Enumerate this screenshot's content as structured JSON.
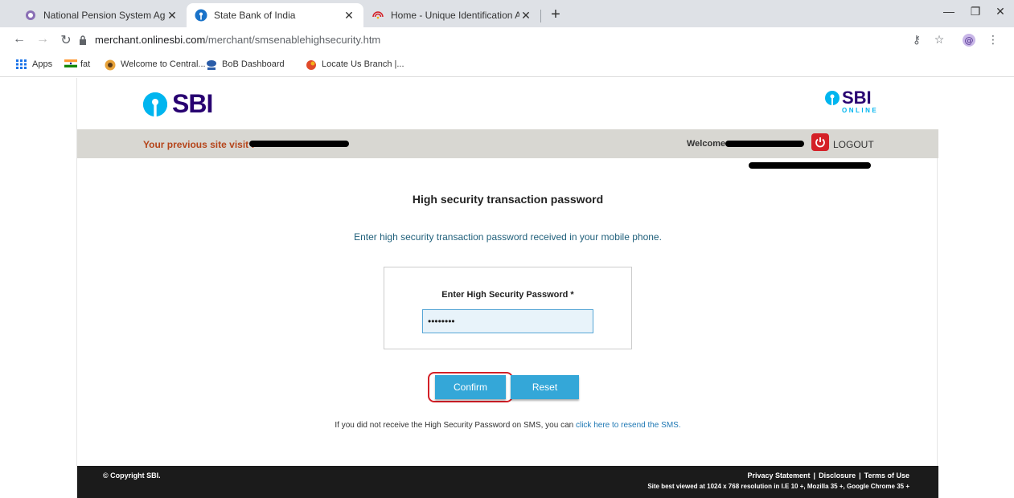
{
  "browser": {
    "tabs": [
      {
        "title": "National Pension System Agent, |",
        "active": false
      },
      {
        "title": "State Bank of India",
        "active": true
      },
      {
        "title": "Home - Unique Identification Au",
        "active": false
      }
    ],
    "address": {
      "host": "merchant.onlinesbi.com",
      "path": "/merchant/smsenablehighsecurity.htm"
    },
    "bookmarks": [
      {
        "label": "Apps"
      },
      {
        "label": "fat"
      },
      {
        "label": "Welcome to Central..."
      },
      {
        "label": "BoB Dashboard"
      },
      {
        "label": "Locate Us Branch |..."
      }
    ]
  },
  "header": {
    "logo_left": "SBI",
    "logo_right_top": "SBI",
    "logo_right_bottom": "ONLINE"
  },
  "strip": {
    "previous_visit_label": "Your previous site visit :",
    "welcome_label": "Welcome",
    "logout_label": "LOGOUT"
  },
  "main": {
    "heading": "High security transaction password",
    "instruction": "Enter high security transaction password received in your mobile phone.",
    "password_label": "Enter High Security Password *",
    "password_value": "••••••••",
    "confirm_label": "Confirm",
    "reset_label": "Reset",
    "resend_text": "If you did not receive the High Security Password on SMS, you can",
    "resend_link": "click here to resend the SMS."
  },
  "footer": {
    "copyright": "© Copyright SBI.",
    "privacy": "Privacy Statement",
    "disclosure": "Disclosure",
    "terms": "Terms of Use",
    "best_viewed": "Site best viewed at 1024 x 768 resolution in I.E 10 +, Mozilla 35 +, Google Chrome 35 +"
  },
  "colors": {
    "sbi_blue": "#00b5ef",
    "sbi_navy": "#280071",
    "button_blue": "#34a7d8",
    "highlight_red": "#d32027"
  }
}
